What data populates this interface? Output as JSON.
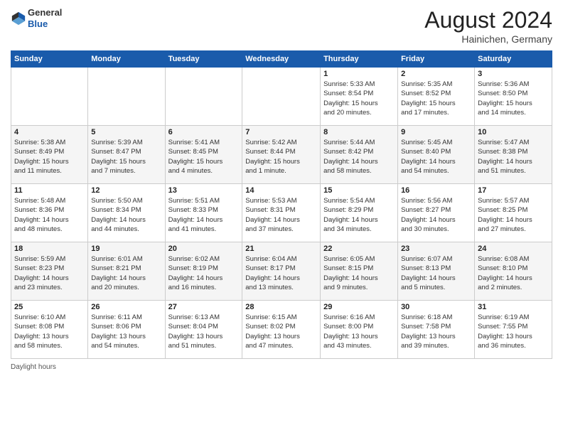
{
  "header": {
    "logo_general": "General",
    "logo_blue": "Blue",
    "month_year": "August 2024",
    "location": "Hainichen, Germany"
  },
  "weekdays": [
    "Sunday",
    "Monday",
    "Tuesday",
    "Wednesday",
    "Thursday",
    "Friday",
    "Saturday"
  ],
  "footer": {
    "daylight_label": "Daylight hours"
  },
  "weeks": [
    [
      {
        "day": "",
        "info": ""
      },
      {
        "day": "",
        "info": ""
      },
      {
        "day": "",
        "info": ""
      },
      {
        "day": "",
        "info": ""
      },
      {
        "day": "1",
        "info": "Sunrise: 5:33 AM\nSunset: 8:54 PM\nDaylight: 15 hours\nand 20 minutes."
      },
      {
        "day": "2",
        "info": "Sunrise: 5:35 AM\nSunset: 8:52 PM\nDaylight: 15 hours\nand 17 minutes."
      },
      {
        "day": "3",
        "info": "Sunrise: 5:36 AM\nSunset: 8:50 PM\nDaylight: 15 hours\nand 14 minutes."
      }
    ],
    [
      {
        "day": "4",
        "info": "Sunrise: 5:38 AM\nSunset: 8:49 PM\nDaylight: 15 hours\nand 11 minutes."
      },
      {
        "day": "5",
        "info": "Sunrise: 5:39 AM\nSunset: 8:47 PM\nDaylight: 15 hours\nand 7 minutes."
      },
      {
        "day": "6",
        "info": "Sunrise: 5:41 AM\nSunset: 8:45 PM\nDaylight: 15 hours\nand 4 minutes."
      },
      {
        "day": "7",
        "info": "Sunrise: 5:42 AM\nSunset: 8:44 PM\nDaylight: 15 hours\nand 1 minute."
      },
      {
        "day": "8",
        "info": "Sunrise: 5:44 AM\nSunset: 8:42 PM\nDaylight: 14 hours\nand 58 minutes."
      },
      {
        "day": "9",
        "info": "Sunrise: 5:45 AM\nSunset: 8:40 PM\nDaylight: 14 hours\nand 54 minutes."
      },
      {
        "day": "10",
        "info": "Sunrise: 5:47 AM\nSunset: 8:38 PM\nDaylight: 14 hours\nand 51 minutes."
      }
    ],
    [
      {
        "day": "11",
        "info": "Sunrise: 5:48 AM\nSunset: 8:36 PM\nDaylight: 14 hours\nand 48 minutes."
      },
      {
        "day": "12",
        "info": "Sunrise: 5:50 AM\nSunset: 8:34 PM\nDaylight: 14 hours\nand 44 minutes."
      },
      {
        "day": "13",
        "info": "Sunrise: 5:51 AM\nSunset: 8:33 PM\nDaylight: 14 hours\nand 41 minutes."
      },
      {
        "day": "14",
        "info": "Sunrise: 5:53 AM\nSunset: 8:31 PM\nDaylight: 14 hours\nand 37 minutes."
      },
      {
        "day": "15",
        "info": "Sunrise: 5:54 AM\nSunset: 8:29 PM\nDaylight: 14 hours\nand 34 minutes."
      },
      {
        "day": "16",
        "info": "Sunrise: 5:56 AM\nSunset: 8:27 PM\nDaylight: 14 hours\nand 30 minutes."
      },
      {
        "day": "17",
        "info": "Sunrise: 5:57 AM\nSunset: 8:25 PM\nDaylight: 14 hours\nand 27 minutes."
      }
    ],
    [
      {
        "day": "18",
        "info": "Sunrise: 5:59 AM\nSunset: 8:23 PM\nDaylight: 14 hours\nand 23 minutes."
      },
      {
        "day": "19",
        "info": "Sunrise: 6:01 AM\nSunset: 8:21 PM\nDaylight: 14 hours\nand 20 minutes."
      },
      {
        "day": "20",
        "info": "Sunrise: 6:02 AM\nSunset: 8:19 PM\nDaylight: 14 hours\nand 16 minutes."
      },
      {
        "day": "21",
        "info": "Sunrise: 6:04 AM\nSunset: 8:17 PM\nDaylight: 14 hours\nand 13 minutes."
      },
      {
        "day": "22",
        "info": "Sunrise: 6:05 AM\nSunset: 8:15 PM\nDaylight: 14 hours\nand 9 minutes."
      },
      {
        "day": "23",
        "info": "Sunrise: 6:07 AM\nSunset: 8:13 PM\nDaylight: 14 hours\nand 5 minutes."
      },
      {
        "day": "24",
        "info": "Sunrise: 6:08 AM\nSunset: 8:10 PM\nDaylight: 14 hours\nand 2 minutes."
      }
    ],
    [
      {
        "day": "25",
        "info": "Sunrise: 6:10 AM\nSunset: 8:08 PM\nDaylight: 13 hours\nand 58 minutes."
      },
      {
        "day": "26",
        "info": "Sunrise: 6:11 AM\nSunset: 8:06 PM\nDaylight: 13 hours\nand 54 minutes."
      },
      {
        "day": "27",
        "info": "Sunrise: 6:13 AM\nSunset: 8:04 PM\nDaylight: 13 hours\nand 51 minutes."
      },
      {
        "day": "28",
        "info": "Sunrise: 6:15 AM\nSunset: 8:02 PM\nDaylight: 13 hours\nand 47 minutes."
      },
      {
        "day": "29",
        "info": "Sunrise: 6:16 AM\nSunset: 8:00 PM\nDaylight: 13 hours\nand 43 minutes."
      },
      {
        "day": "30",
        "info": "Sunrise: 6:18 AM\nSunset: 7:58 PM\nDaylight: 13 hours\nand 39 minutes."
      },
      {
        "day": "31",
        "info": "Sunrise: 6:19 AM\nSunset: 7:55 PM\nDaylight: 13 hours\nand 36 minutes."
      }
    ]
  ]
}
